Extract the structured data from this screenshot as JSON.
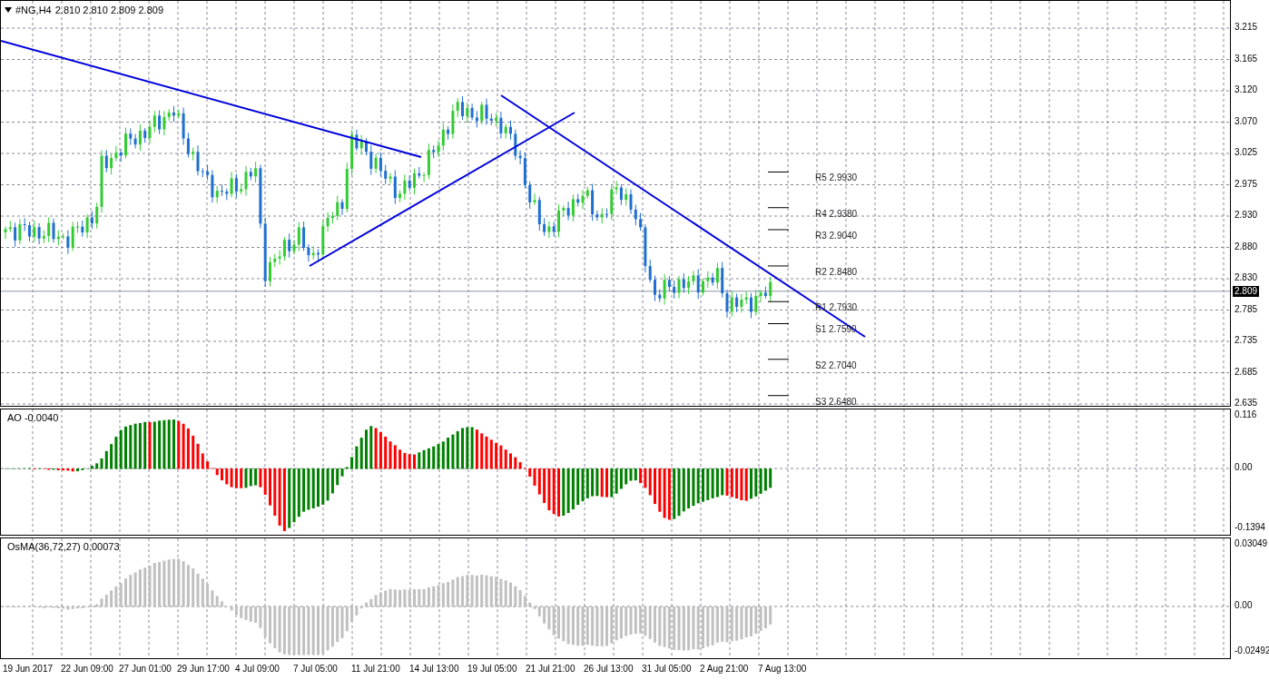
{
  "chart": {
    "symbol": "#NG,H4",
    "quote": "2.810 2.810 2.809 2.809",
    "current_price": "2.809",
    "price_axis": [
      "3.215",
      "3.165",
      "3.120",
      "3.070",
      "3.025",
      "2.975",
      "2.930",
      "2.880",
      "2.830",
      "2.785",
      "2.735",
      "2.685",
      "2.635"
    ],
    "pivots": [
      {
        "label": "R5 2.9930"
      },
      {
        "label": "R4 2.9380"
      },
      {
        "label": "R3 2.9040"
      },
      {
        "label": "R2 2.8480"
      },
      {
        "label": "R1 2.7930"
      },
      {
        "label": "S1 2.7590"
      },
      {
        "label": "S2 2.7040"
      },
      {
        "label": "S3 2.6480"
      }
    ]
  },
  "indicators": [
    {
      "kind": "ao",
      "label": "AO -0.0040",
      "axis": [
        "0.116",
        "0.00",
        "-0.1394"
      ]
    },
    {
      "kind": "osma",
      "label": "OsMA(36,72,27) 0.00073",
      "axis": [
        "0.03049",
        "0.00",
        "-0.02492"
      ]
    }
  ],
  "time_axis": [
    "19 Jun 2017",
    "22 Jun 09:00",
    "27 Jun 01:00",
    "29 Jun 17:00",
    "4 Jul 09:00",
    "7 Jul 05:00",
    "11 Jul 21:00",
    "14 Jul 13:00",
    "19 Jul 05:00",
    "21 Jul 21:00",
    "26 Jul 13:00",
    "31 Jul 05:00",
    "2 Aug 21:00",
    "7 Aug 13:00"
  ]
}
